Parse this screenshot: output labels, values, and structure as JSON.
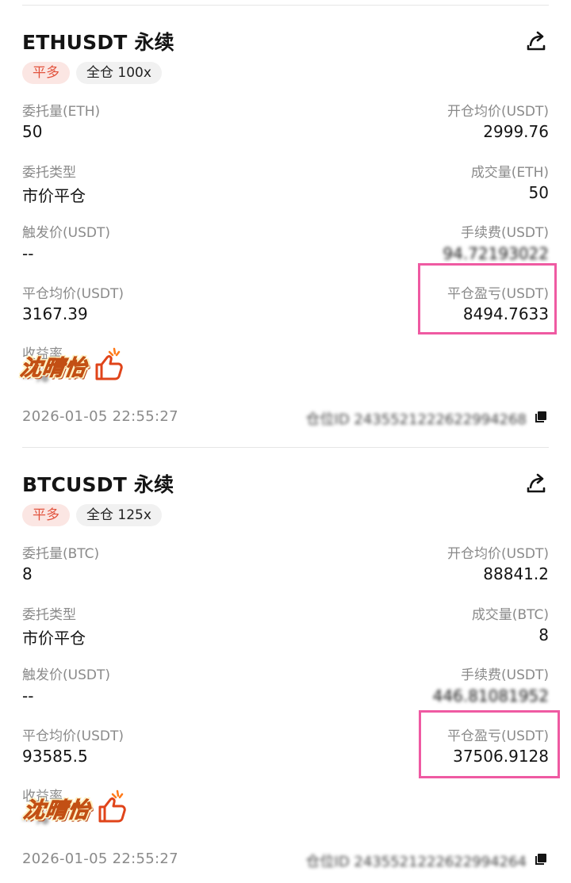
{
  "orders": [
    {
      "title": "ETHUSDT 永续",
      "side_tag": "平多",
      "mode_tag": "全仓 100x",
      "order_qty_label": "委托量(ETH)",
      "order_qty": "50",
      "open_avg_label": "开仓均价(USDT)",
      "open_avg": "2999.76",
      "order_type_label": "委托类型",
      "order_type": "市价平仓",
      "filled_label": "成交量(ETH)",
      "filled": "50",
      "trigger_label": "触发价(USDT)",
      "trigger": "--",
      "fee_label": "手续费(USDT)",
      "fee": "94.72193022",
      "close_avg_label": "平仓均价(USDT)",
      "close_avg": "3167.39",
      "pnl_label": "平仓盈亏(USDT)",
      "pnl": "8494.7633",
      "roi_label": "收益率",
      "roi": "--%",
      "watermark": "沈晴怡",
      "time": "2026-01-05  22:55:27",
      "position_id": "仓位ID 2435521222622994268"
    },
    {
      "title": "BTCUSDT 永续",
      "side_tag": "平多",
      "mode_tag": "全仓 125x",
      "order_qty_label": "委托量(BTC)",
      "order_qty": "8",
      "open_avg_label": "开仓均价(USDT)",
      "open_avg": "88841.2",
      "order_type_label": "委托类型",
      "order_type": "市价平仓",
      "filled_label": "成交量(BTC)",
      "filled": "8",
      "trigger_label": "触发价(USDT)",
      "trigger": "--",
      "fee_label": "手续费(USDT)",
      "fee": "446.81081952",
      "close_avg_label": "平仓均价(USDT)",
      "close_avg": "93585.5",
      "pnl_label": "平仓盈亏(USDT)",
      "pnl": "37506.9128",
      "roi_label": "收益率",
      "roi": "--%",
      "watermark": "沈晴怡",
      "time": "2026-01-05  22:55:27",
      "position_id": "仓位ID 2435521222622994264"
    }
  ],
  "colors": {
    "side_tag_bg": "#fbe6e3",
    "side_tag_text": "#e2533e",
    "highlight_border": "#ef5aa2"
  },
  "icons": [
    "share-icon",
    "copy-icon",
    "thumbs-up-icon"
  ]
}
